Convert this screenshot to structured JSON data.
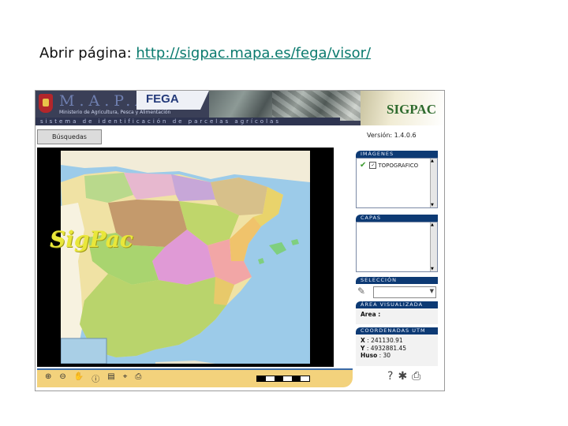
{
  "slide": {
    "prefix": "Abrir página: ",
    "link": "http://sigpac.mapa.es/fega/visor/"
  },
  "banner": {
    "mapa": "M.A.P.A.",
    "ministerio": "Ministerio de Agricultura, Pesca y Alimentación",
    "fega": "FEGA",
    "sistema": "sistema de identificación de parcelas agrícolas",
    "sigpac": "SIGPAC"
  },
  "toolbar": {
    "busquedas": "Búsquedas",
    "version": "Versión: 1.4.0.6"
  },
  "map": {
    "watermark": "SigPac"
  },
  "panel": {
    "imagenes_title": "IMÁGENES",
    "imagenes_item": "TOPOGRAFICO",
    "capas_title": "CAPAS",
    "seleccion_title": "SELECCIÓN",
    "area_title": "ÁREA VISUALIZADA",
    "area_label": "Area :",
    "coord_title": "COORDENADAS UTM",
    "x_label": "X",
    "x_value": ": 241130.91",
    "y_label": "Y",
    "y_value": ": 4932881.45",
    "huso_label": "Huso",
    "huso_value": ": 30"
  },
  "colors": {
    "link": "#0a7a6e",
    "panel_header": "#0d3a74",
    "toolbar": "#f3d27c",
    "sea": "#9ccbe9"
  },
  "icons": [
    "zoom-in-icon",
    "zoom-out-icon",
    "pan-hand-icon",
    "info-icon",
    "layers-icon",
    "measure-icon",
    "print-icon",
    "help-icon",
    "settings-icon",
    "printer-icon"
  ]
}
